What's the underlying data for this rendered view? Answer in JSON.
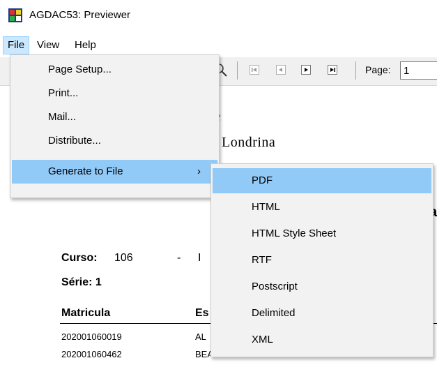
{
  "window": {
    "title": "AGDAC53: Previewer"
  },
  "menubar": {
    "file": "File",
    "view": "View",
    "help": "Help"
  },
  "toolbar": {
    "page_label": "Page:",
    "page_value": "1"
  },
  "file_menu": {
    "items": [
      {
        "label": "Page Setup..."
      },
      {
        "label": "Print..."
      },
      {
        "label": "Mail..."
      },
      {
        "label": "Distribute..."
      },
      {
        "label": "Generate to File",
        "arrow": "›"
      }
    ]
  },
  "generate_submenu": {
    "items": [
      {
        "label": "PDF"
      },
      {
        "label": "HTML"
      },
      {
        "label": "HTML Style Sheet"
      },
      {
        "label": "RTF"
      },
      {
        "label": "Postscript"
      },
      {
        "label": "Delimited"
      },
      {
        "label": "XML"
      }
    ]
  },
  "report": {
    "header_line1": "de",
    "header_line2": "Londrina",
    "header_bold_fragment": "a",
    "curso_label": "Curso:",
    "curso_value": "106",
    "curso_dash": "-",
    "curso_fragment": "I",
    "serie_label": "Série: 1",
    "col_matricula": "Matricula",
    "col_estudante_fragment": "Es",
    "rows": [
      {
        "matricula": "202001060019",
        "name_fragment": "AL"
      },
      {
        "matricula": "202001060462",
        "name_fragment": "BEATRIZ CLETO BELTRAMI"
      }
    ]
  },
  "colors": {
    "highlight": "#91c9f7",
    "menu_bg": "#f2f2f2",
    "file_active": "#cce8ff"
  }
}
